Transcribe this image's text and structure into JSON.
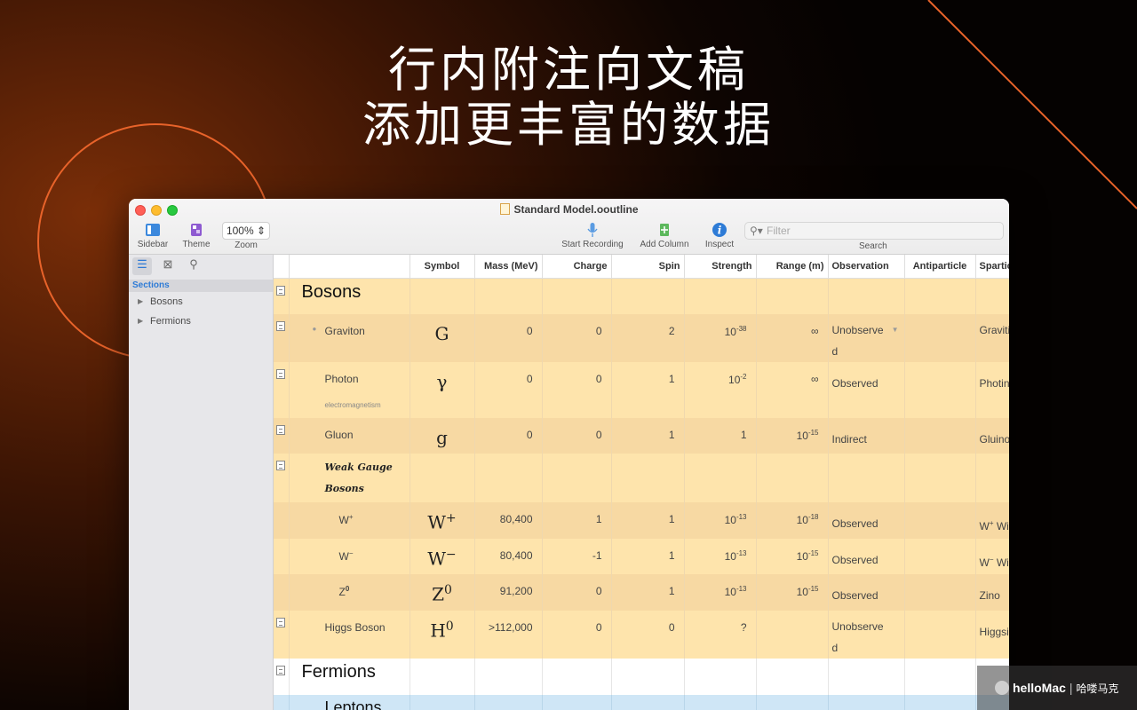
{
  "hero": {
    "line1": "行内附注向文稿",
    "line2": "添加更丰富的数据"
  },
  "window": {
    "title": "Standard Model.ooutline"
  },
  "toolbar": {
    "sidebar_label": "Sidebar",
    "theme_label": "Theme",
    "zoom_value": "100%",
    "zoom_label": "Zoom",
    "record_label": "Start Recording",
    "add_column_label": "Add Column",
    "inspect_label": "Inspect",
    "filter_placeholder": "Filter",
    "search_label": "Search"
  },
  "sidebar": {
    "heading": "Sections",
    "items": [
      {
        "label": "Bosons"
      },
      {
        "label": "Fermions"
      }
    ]
  },
  "columns": [
    "Symbol",
    "Mass (MeV)",
    "Charge",
    "Spin",
    "Strength",
    "Range (m)",
    "Observation",
    "Antiparticle",
    "Sparticl"
  ],
  "rows": {
    "bosons": {
      "topic": "Bosons"
    },
    "graviton": {
      "topic": "Graviton",
      "symbol": "G",
      "mass": "0",
      "charge": "0",
      "spin": "2",
      "strength_base": "10",
      "strength_exp": "-38",
      "range": "∞",
      "observation": "Unobserve",
      "observation_wrap": "d",
      "sparticle": "Gravitin"
    },
    "photon": {
      "topic": "Photon",
      "note": "electromagnetism",
      "symbol": "γ",
      "mass": "0",
      "charge": "0",
      "spin": "1",
      "strength_base": "10",
      "strength_exp": "-2",
      "range": "∞",
      "observation": "Observed",
      "sparticle": "Photino"
    },
    "gluon": {
      "topic": "Gluon",
      "symbol": "g",
      "mass": "0",
      "charge": "0",
      "spin": "1",
      "strength": "1",
      "range_base": "10",
      "range_exp": "-15",
      "observation": "Indirect",
      "sparticle": "Gluino"
    },
    "weak": {
      "topic_line1": "Weak Gauge",
      "topic_line2": "Bosons"
    },
    "wplus": {
      "topic_base": "W",
      "topic_exp": "+",
      "symbol_base": "W",
      "symbol_exp": "+",
      "mass": "80,400",
      "charge": "1",
      "spin": "1",
      "strength_base": "10",
      "strength_exp": "-13",
      "range_base": "10",
      "range_exp": "-18",
      "observation": "Observed",
      "sparticle_base": "W",
      "sparticle_exp": "+",
      "sparticle_rest": " Wi"
    },
    "wminus": {
      "topic_base": "W",
      "topic_exp": "−",
      "symbol_base": "W",
      "symbol_exp": "−",
      "mass": "80,400",
      "charge": "-1",
      "spin": "1",
      "strength_base": "10",
      "strength_exp": "-13",
      "range_base": "10",
      "range_exp": "-15",
      "observation": "Observed",
      "sparticle_base": "W",
      "sparticle_exp": "−",
      "sparticle_rest": " Wi"
    },
    "z0": {
      "topic_base": "Z",
      "topic_exp": "0",
      "symbol_base": "Z",
      "symbol_exp": "0",
      "mass": "91,200",
      "charge": "0",
      "spin": "1",
      "strength_base": "10",
      "strength_exp": "-13",
      "range_base": "10",
      "range_exp": "-15",
      "observation": "Observed",
      "sparticle": "Zino"
    },
    "higgs": {
      "topic": "Higgs Boson",
      "symbol_base": "H",
      "symbol_exp": "0",
      "mass": ">112,000",
      "charge": "0",
      "spin": "0",
      "strength": "?",
      "observation": "Unobserve",
      "observation_wrap": "d",
      "sparticle": "Higgsino"
    },
    "fermions": {
      "topic": "Fermions"
    },
    "leptons": {
      "topic": "Leptons"
    }
  },
  "watermark": {
    "brand": "helloMac",
    "sep": "|",
    "cn": "哈喽马克"
  },
  "colors": {
    "row_tan": "#fee4ac",
    "row_blue": "#cfe6f6",
    "accent": "#2e7bd6",
    "bg_orange": "#e8632a"
  }
}
